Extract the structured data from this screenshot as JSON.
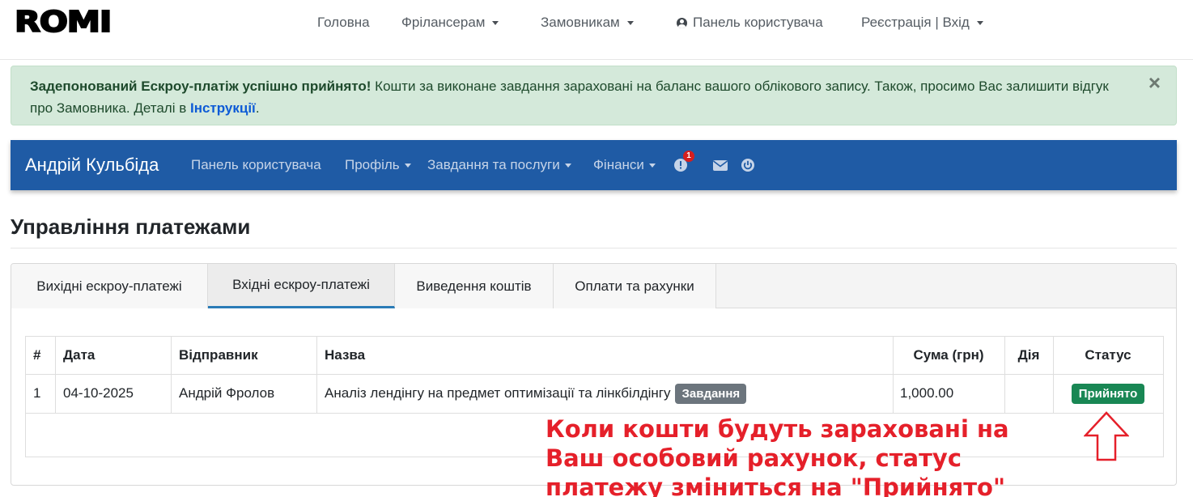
{
  "topnav": {
    "logo": "ROMI",
    "links": [
      {
        "label": "Головна"
      },
      {
        "label": "Фрілансерам"
      },
      {
        "label": "Замовникам"
      },
      {
        "label": "Панель користувача"
      },
      {
        "label": "Реєстрація | Вхід"
      }
    ]
  },
  "alert": {
    "bold": "Задепонований Ескроу-платіж успішно прийнято!",
    "text": " Кошти за виконане завдання зараховані на баланс вашого облікового запису. Також, просимо Вас залишити відгук про Замовника. Деталі в ",
    "link": "Інструкції",
    "end": ".",
    "close": "×"
  },
  "usernav": {
    "brand": "Андрій Кульбіда",
    "links": [
      {
        "label": "Панель користувача"
      },
      {
        "label": "Профіль"
      },
      {
        "label": "Завдання та послуги"
      },
      {
        "label": "Фінанси"
      }
    ],
    "notification_count": "1",
    "icons": [
      "alert-icon",
      "mail-icon",
      "power-icon"
    ]
  },
  "page": {
    "title": "Управління платежами"
  },
  "tabs": [
    {
      "label": "Вихідні ескроу-платежі"
    },
    {
      "label": "Вхідні ескроу-платежі",
      "active": true
    },
    {
      "label": "Виведення коштів"
    },
    {
      "label": "Оплати та рахунки"
    }
  ],
  "table": {
    "headers": [
      "#",
      "Дата",
      "Відправник",
      "Назва",
      "Сума (грн)",
      "Дія",
      "Статус"
    ],
    "rows": [
      {
        "num": "1",
        "date": "04-10-2025",
        "sender": "Андрій Фролов",
        "title": "Аналіз лендінгу на предмет оптимізації та лінкбілдінгу",
        "tag": "Завдання",
        "amount": "1,000.00",
        "action": "",
        "status": "Прийнято"
      }
    ]
  },
  "annotation": {
    "text": "Коли кошти будуть зараховані на Ваш особовий рахунок, статус платежу зміниться на \"Прийнято\""
  },
  "colors": {
    "navbar": "#1f5ba5",
    "alert_bg": "#d4e9da",
    "status_green": "#198754",
    "tag_gray": "#6c757d",
    "annotation_red": "#e5202a"
  }
}
